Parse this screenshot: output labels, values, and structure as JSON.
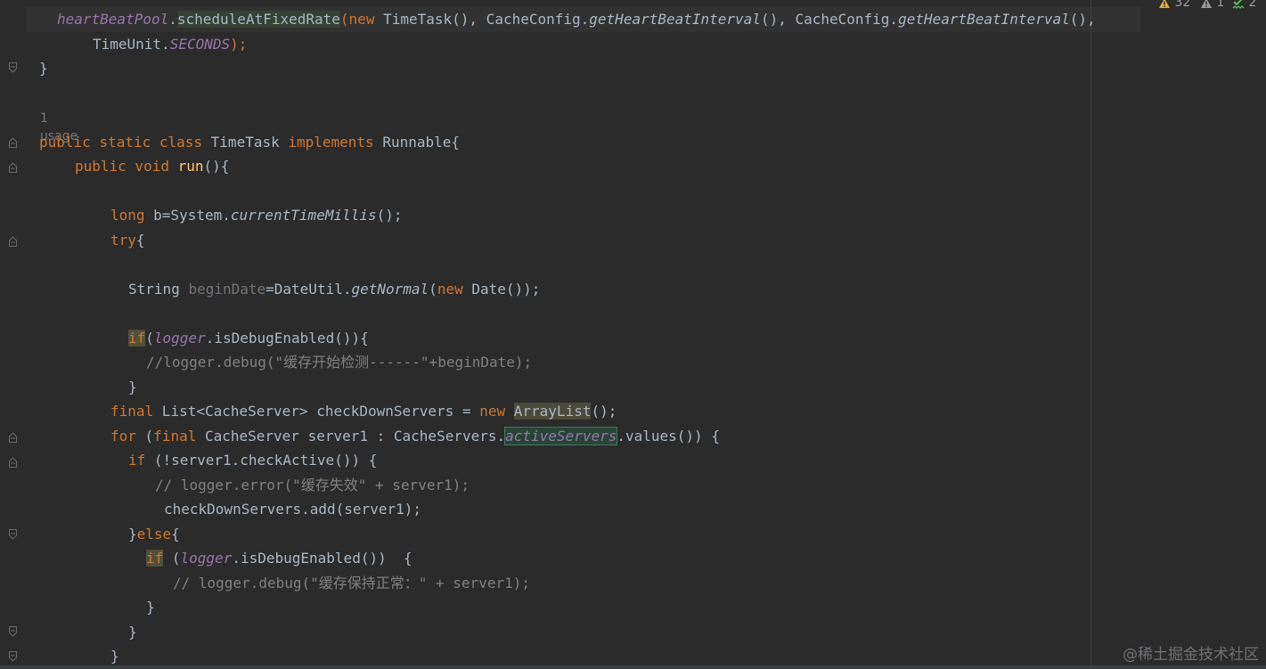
{
  "inspections": {
    "warnings": "32",
    "weak_warnings": "1",
    "typos": "2"
  },
  "usage_hint": "1 usage",
  "watermark": "@稀土掘金技术社区",
  "code": {
    "l1": {
      "a": "heartBeatPool",
      "b": ".",
      "c": "scheduleAtFixedRate",
      "d": "(",
      "e": "new",
      "f": " TimeTask(), CacheConfig.",
      "g": "getHeartBeatInterval",
      "h": "(), CacheConfig.",
      "i": "getHeartBeatInterval",
      "j": "(),"
    },
    "l2": {
      "a": "TimeUnit.",
      "b": "SECONDS",
      "c": ");"
    },
    "l3": {
      "a": "}"
    },
    "l4": {
      "a": "public static class",
      "b": " TimeTask ",
      "c": "implements",
      "d": " Runnable{"
    },
    "l5": {
      "a": "public void",
      "b": " ",
      "c": "run",
      "d": "(){"
    },
    "l6": {
      "a": "long",
      "b": " b=System.",
      "c": "currentTimeMillis",
      "d": "();"
    },
    "l7": {
      "a": "try",
      "b": "{"
    },
    "l8": {
      "a": "String ",
      "b": "beginDate",
      "c": "=DateUtil.",
      "d": "getNormal",
      "e": "(",
      "f": "new",
      "g": " Date());"
    },
    "l9": {
      "a": "if",
      "b": "(",
      "c": "logger",
      "d": ".isDebugEnabled()){"
    },
    "l10": {
      "a": "//logger.debug(\"缓存开始检测------\"+beginDate);"
    },
    "l11": {
      "a": "}"
    },
    "l12": {
      "a": "final",
      "b": " List<CacheServer> checkDownServers = ",
      "c": "new",
      "d": " ",
      "e": "ArrayList",
      "f": "();"
    },
    "l13": {
      "a": "for",
      "b": " (",
      "c": "final",
      "d": " CacheServer server1 : CacheServers.",
      "e": "activeServers",
      "f": ".values()) {"
    },
    "l14": {
      "a": "if",
      "b": " (!server1.checkActive()) {"
    },
    "l15": {
      "a": "// logger.error(\"缓存失效\" + server1);"
    },
    "l16": {
      "a": "checkDownServers.add(server1);"
    },
    "l17": {
      "a": "}",
      "b": "else",
      "c": "{"
    },
    "l18": {
      "a": "if",
      "b": " (",
      "c": "logger",
      "d": ".isDebugEnabled())  {"
    },
    "l19": {
      "a": "// logger.debug(\"缓存保持正常：\" + server1);"
    },
    "l20": {
      "a": "}"
    },
    "l21": {
      "a": "}"
    },
    "l22": {
      "a": "}"
    }
  },
  "colors": {
    "background": "#2b2b2b",
    "keyword": "#cc7832",
    "method_decl": "#ffc66d",
    "field": "#9876aa",
    "comment": "#808080",
    "default_text": "#a9b7c6",
    "warning_icon": "#e0a840",
    "typo_icon": "#5fb95f"
  }
}
